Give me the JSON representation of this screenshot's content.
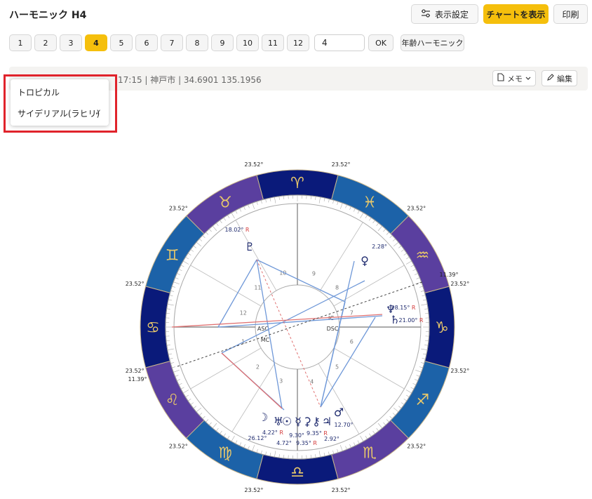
{
  "header": {
    "title": "ハーモニック H4",
    "display_settings_label": "表示設定",
    "show_chart_label": "チャートを表示",
    "print_label": "印刷"
  },
  "harmonics": {
    "buttons": [
      "1",
      "2",
      "3",
      "4",
      "5",
      "6",
      "7",
      "8",
      "9",
      "10",
      "11",
      "12"
    ],
    "active": "4",
    "input_value": "4",
    "ok_label": "OK",
    "age_harmonic_label": "年齢ハーモニック"
  },
  "info": {
    "text": "17:15 | 神戸市 | 34.6901 135.1956",
    "memo_label": "メモ",
    "edit_label": "編集"
  },
  "dropdown": {
    "items": [
      "トロピカル",
      "サイデリアル(ラヒリ)"
    ],
    "selected": "サイデリアル(ラヒリ)"
  },
  "chart": {
    "sign_degree_label": "23.52°",
    "extra_degree_label": "11.39°",
    "houses": [
      "1",
      "2",
      "3",
      "4",
      "5",
      "6",
      "7",
      "8",
      "9",
      "10",
      "11",
      "12"
    ],
    "angles": {
      "asc": "ASC",
      "mc": "MC",
      "ic": "IC",
      "dsc": "DSC"
    },
    "planet_labels": {
      "pluto": "18.02°",
      "venus": "2.28°",
      "neptune": "28.15°",
      "saturn": "21.00°",
      "moon": "26.12°",
      "sun": "4.22°",
      "mercury": "4.72°",
      "uranus": "9.30°",
      "mars_a": "9.35°",
      "mars_b": "9.35°",
      "jupiter": "2.92°",
      "mars": "12.70°"
    },
    "retro_mark": "R",
    "colors": {
      "wheel_dark": "#0a1a7a",
      "wheel_blue": "#1c62a8",
      "wheel_purple": "#5a3f9f",
      "glyph_gold": "#e9c86a"
    }
  }
}
